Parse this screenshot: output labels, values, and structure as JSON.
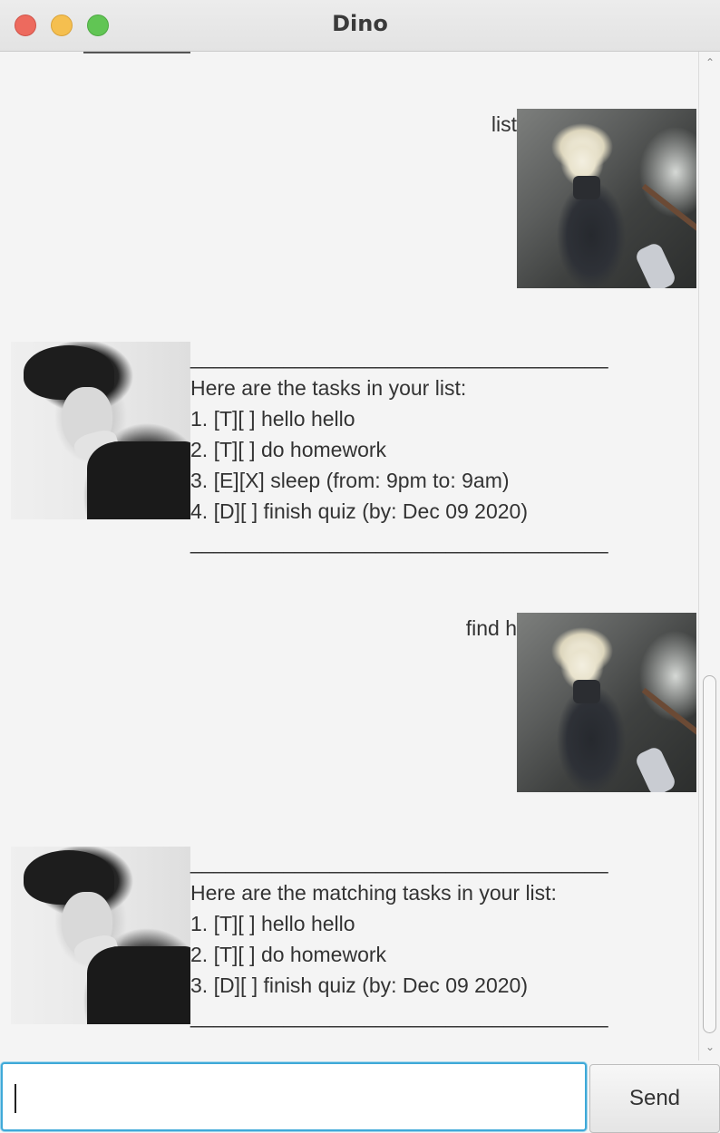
{
  "window": {
    "title": "Dino"
  },
  "dialog": [
    {
      "sender": "user",
      "lines": [
        "list"
      ]
    },
    {
      "sender": "dino",
      "lines": [
        "____________________________________",
        "Here are the tasks in your list:",
        "1. [T][ ] hello hello",
        "2. [T][ ] do homework",
        "3. [E][X] sleep (from: 9pm to: 9am)",
        "4. [D][ ] finish quiz (by: Dec 09 2020)",
        "____________________________________"
      ]
    },
    {
      "sender": "user",
      "lines": [
        "find h"
      ]
    },
    {
      "sender": "dino",
      "lines": [
        "____________________________________",
        "Here are the matching tasks in your list:",
        "1. [T][ ] hello hello",
        "2. [T][ ] do homework",
        "3. [D][ ] finish quiz (by: Dec 09 2020)",
        "____________________________________"
      ]
    }
  ],
  "input": {
    "value": "",
    "placeholder": ""
  },
  "send_button": {
    "label": "Send"
  },
  "colors": {
    "background": "#f4f4f4",
    "input_focus": "#3fa9d8",
    "close": "#ed6a5e",
    "minimize": "#f5bf4f",
    "maximize": "#61c554"
  }
}
